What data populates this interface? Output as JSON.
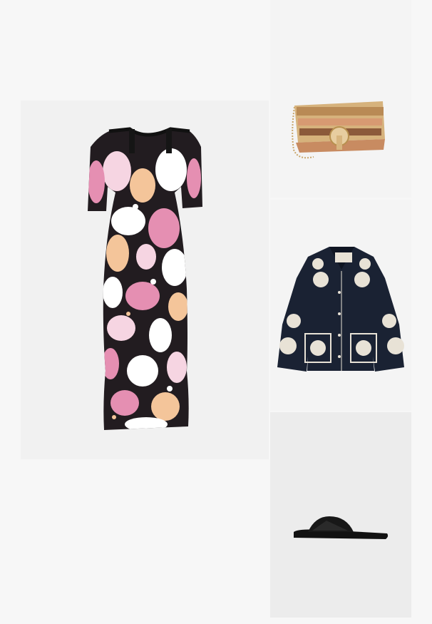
{
  "outfit": {
    "items": [
      {
        "kind": "dress",
        "icon": "patterned-dress-image",
        "pattern_colors": [
          "#1e1a1c",
          "#e58fb2",
          "#f4c59a",
          "#ffffff",
          "#f6d5e2"
        ]
      },
      {
        "kind": "bag",
        "icon": "woven-bag-image",
        "pattern_colors": [
          "#b98a55",
          "#d79a72",
          "#8c5a3a",
          "#d6b27c"
        ]
      },
      {
        "kind": "jacket",
        "icon": "embroidered-jacket-image",
        "pattern_colors": [
          "#1a2233",
          "#e8e2d6"
        ]
      },
      {
        "kind": "sandal",
        "icon": "sandal-image",
        "pattern_colors": [
          "#181818"
        ]
      }
    ]
  }
}
